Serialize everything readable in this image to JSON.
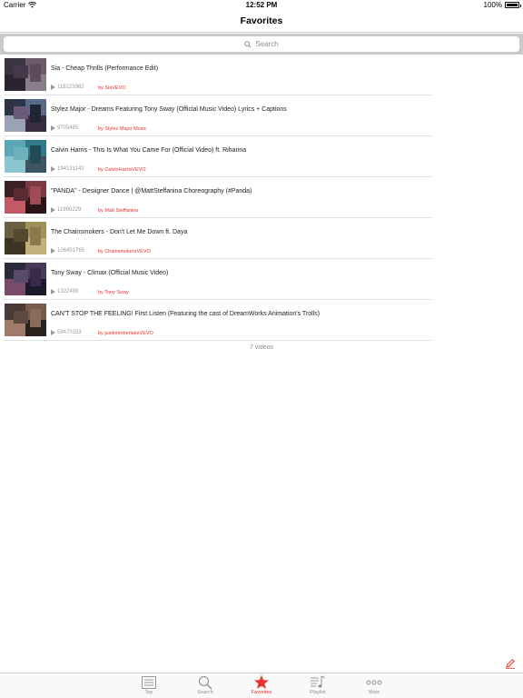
{
  "status_bar": {
    "carrier": "Carrier",
    "time": "12:52 PM",
    "battery_text": "100%",
    "battery_level": 1.0
  },
  "nav": {
    "title": "Favorites"
  },
  "search": {
    "placeholder": "Search"
  },
  "colors": {
    "accent": "#e8312f",
    "separator": "#e2e2e4",
    "search_bg": "#c9c9ce"
  },
  "videos": [
    {
      "title": "Sia - Cheap Thrills (Performance Edit)",
      "views": "118223982",
      "channel": "by SiaVEVO",
      "thumb_colors": [
        "#3a3540",
        "#6f5a6a",
        "#2a2430",
        "#8a7d8a",
        "#44384a",
        "#5d4a5a"
      ]
    },
    {
      "title": "Stylez Major - Dreams Featuring Tony Sway (Official Music Video)  Lyrics + Captions",
      "views": "9705485",
      "channel": "by Stylez Major Music",
      "thumb_colors": [
        "#2d3446",
        "#5a6a8a",
        "#9aa3b5",
        "#3b2d40",
        "#6b5a7a",
        "#1f2535"
      ]
    },
    {
      "title": "Calvin Harris - This Is What You Came For (Official Video) ft. Rihanna",
      "views": "194131142",
      "channel": "by CalvinHarrisVEVO",
      "thumb_colors": [
        "#5aa7b8",
        "#2c7a8c",
        "#8cc5cf",
        "#3d5560",
        "#6fb0bd",
        "#244a55"
      ]
    },
    {
      "title": "\"PANDA\" - Desiigner Dance | @MattSteffanina Choreography (#Panda)",
      "views": "11990229",
      "channel": "by Matt Steffanina",
      "thumb_colors": [
        "#3a1f24",
        "#7a3a44",
        "#c25a66",
        "#2a1418",
        "#5a2a32",
        "#a04a55"
      ]
    },
    {
      "title": "The Chainsmokers - Don't Let Me Down ft. Daya",
      "views": "106451765",
      "channel": "by ChainsmokersVEVO",
      "thumb_colors": [
        "#6a5f40",
        "#a0905a",
        "#3d3524",
        "#c2b07a",
        "#544a30",
        "#8a7a4d"
      ]
    },
    {
      "title": "Tony Sway - Climax (Official Music Video)",
      "views": "1322498",
      "channel": "by Tony Sway",
      "thumb_colors": [
        "#2a2a3a",
        "#4a3a5a",
        "#7a4a6a",
        "#1a1a2a",
        "#5a4a6a",
        "#3a2a4a"
      ]
    },
    {
      "title": "CAN'T STOP THE FEELING! First Listen (Featuring the cast of DreamWorks Animation's Trolls)",
      "views": "59470153",
      "channel": "by justintimberlakeVEVO",
      "thumb_colors": [
        "#4a3a35",
        "#7a5a4d",
        "#a07a6a",
        "#2a201c",
        "#5a4a40",
        "#8a6a5a"
      ]
    }
  ],
  "footer": {
    "count_label": "7 videos"
  },
  "tabs": [
    {
      "label": "Top",
      "icon": "list-icon",
      "active": false
    },
    {
      "label": "Search",
      "icon": "magnifier-icon",
      "active": false
    },
    {
      "label": "Favorites",
      "icon": "star-icon",
      "active": true
    },
    {
      "label": "Playlist",
      "icon": "music-list-icon",
      "active": false
    },
    {
      "label": "More",
      "icon": "more-dots-icon",
      "active": false
    }
  ]
}
